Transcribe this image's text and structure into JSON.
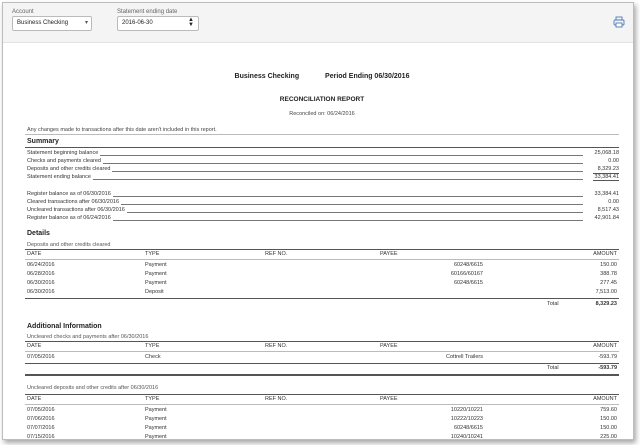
{
  "toolbar": {
    "account_label": "Account",
    "account_value": "Business Checking",
    "statement_label": "Statement ending date",
    "statement_value": "2016-06-30",
    "print_icon": "printer-icon"
  },
  "report": {
    "account_name": "Business Checking",
    "period": "Period Ending 06/30/2016",
    "title": "RECONCILIATION REPORT",
    "reconciled_on": "Reconciled on: 06/24/2016",
    "note": "Any changes made to transactions after this date aren't included in this report.",
    "summary_heading": "Summary",
    "summary_rows": [
      {
        "label": "Statement beginning balance",
        "value": "25,068.18"
      },
      {
        "label": "Checks and payments cleared",
        "value": "0.00"
      },
      {
        "label": "Deposits and other credits cleared",
        "value": "8,329.23"
      },
      {
        "label": "Statement ending balance",
        "value": "33,384.41"
      }
    ],
    "register_rows": [
      {
        "label": "Register balance as of 06/30/2016",
        "value": "33,384.41"
      },
      {
        "label": "Cleared transactions after 06/30/2016",
        "value": "0.00"
      },
      {
        "label": "Uncleared transactions after 06/30/2016",
        "value": "8,517.43"
      },
      {
        "label": "Register balance as of 06/24/2016",
        "value": "42,901.84"
      }
    ],
    "details_heading": "Details",
    "deposits_sub": "Deposits and other credits cleared",
    "columns": {
      "date": "DATE",
      "type": "TYPE",
      "ref": "REF NO.",
      "payee": "PAYEE",
      "amount": "AMOUNT"
    },
    "deposits_rows": [
      {
        "date": "06/24/2016",
        "type": "Payment",
        "ref": "",
        "payee": "60248/6615",
        "amount": "150.00"
      },
      {
        "date": "06/28/2016",
        "type": "Payment",
        "ref": "",
        "payee": "60166/60167",
        "amount": "388.78"
      },
      {
        "date": "06/30/2016",
        "type": "Payment",
        "ref": "",
        "payee": "60248/6615",
        "amount": "277.45"
      },
      {
        "date": "06/30/2016",
        "type": "Deposit",
        "ref": "",
        "payee": "",
        "amount": "7,513.00"
      }
    ],
    "deposits_total_label": "Total",
    "deposits_total": "8,329.23",
    "additional_heading": "Additional Information",
    "uncleared_checks_sub": "Uncleared checks and payments after 06/30/2016",
    "uncleared_checks_rows": [
      {
        "date": "07/05/2016",
        "type": "Check",
        "ref": "",
        "payee": "Cottrell Trailers",
        "amount": "-593.79"
      }
    ],
    "uncleared_checks_total_label": "Total",
    "uncleared_checks_total": "-593.79",
    "uncleared_deposits_sub": "Uncleared deposits and other credits after 06/30/2016",
    "uncleared_deposits_rows": [
      {
        "date": "07/05/2016",
        "type": "Payment",
        "ref": "",
        "payee": "10220/10221",
        "amount": "759.60"
      },
      {
        "date": "07/06/2016",
        "type": "Payment",
        "ref": "",
        "payee": "10222/10223",
        "amount": "150.00"
      },
      {
        "date": "07/07/2016",
        "type": "Payment",
        "ref": "",
        "payee": "60248/6615",
        "amount": "150.00"
      },
      {
        "date": "07/15/2016",
        "type": "Payment",
        "ref": "",
        "payee": "10240/10241",
        "amount": "225.00"
      }
    ]
  }
}
